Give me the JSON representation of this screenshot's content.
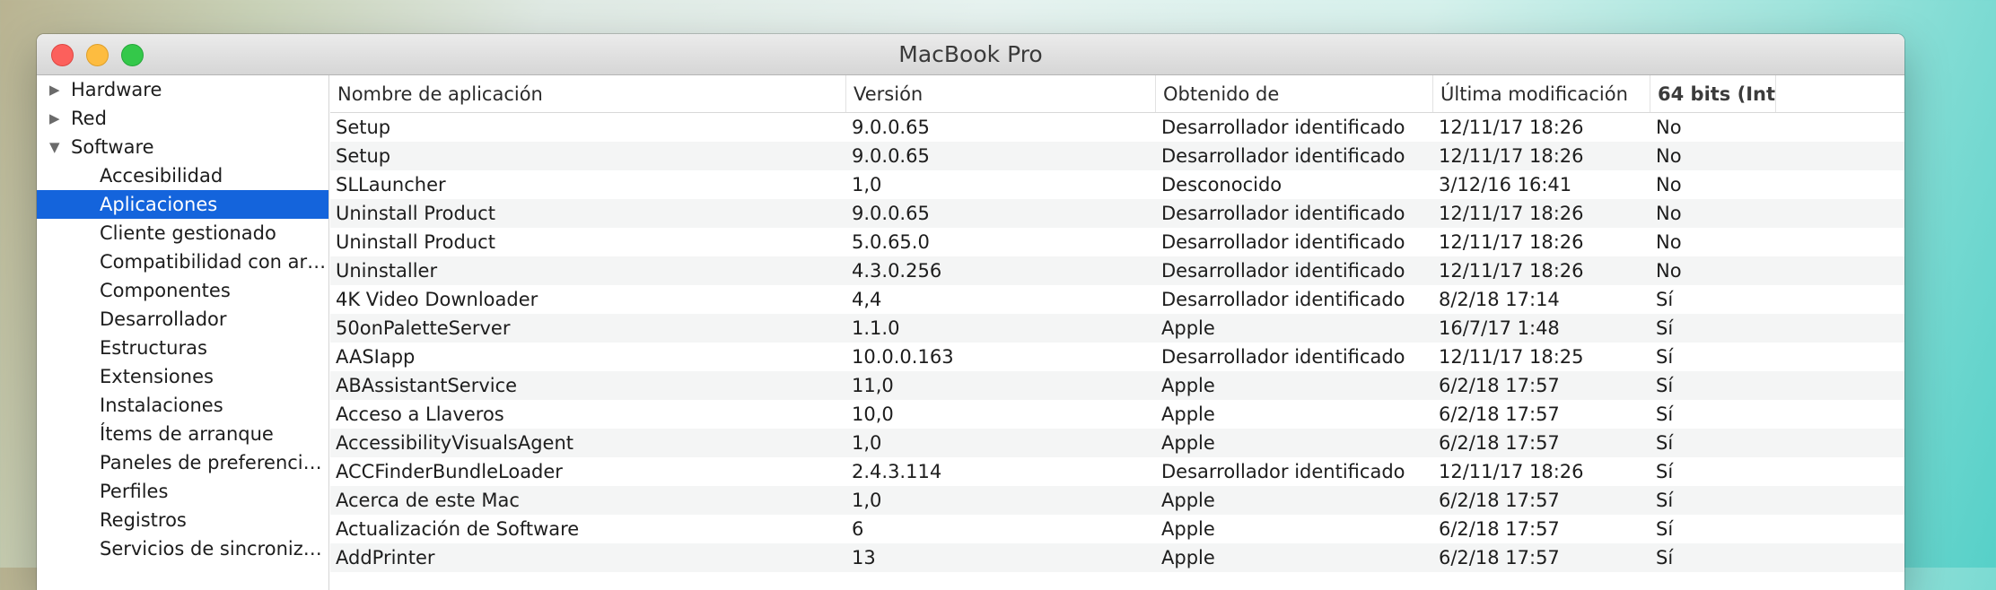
{
  "window": {
    "title": "MacBook Pro"
  },
  "sidebar": {
    "items": [
      {
        "label": "Hardware",
        "level": 0,
        "expanded": false,
        "selected": false
      },
      {
        "label": "Red",
        "level": 0,
        "expanded": false,
        "selected": false
      },
      {
        "label": "Software",
        "level": 0,
        "expanded": true,
        "selected": false
      },
      {
        "label": "Accesibilidad",
        "level": 1,
        "selected": false
      },
      {
        "label": "Aplicaciones",
        "level": 1,
        "selected": true
      },
      {
        "label": "Cliente gestionado",
        "level": 1,
        "selected": false
      },
      {
        "label": "Compatibilidad con ar…",
        "level": 1,
        "selected": false
      },
      {
        "label": "Componentes",
        "level": 1,
        "selected": false
      },
      {
        "label": "Desarrollador",
        "level": 1,
        "selected": false
      },
      {
        "label": "Estructuras",
        "level": 1,
        "selected": false
      },
      {
        "label": "Extensiones",
        "level": 1,
        "selected": false
      },
      {
        "label": "Instalaciones",
        "level": 1,
        "selected": false
      },
      {
        "label": "Ítems de arranque",
        "level": 1,
        "selected": false
      },
      {
        "label": "Paneles de preferenci…",
        "level": 1,
        "selected": false
      },
      {
        "label": "Perfiles",
        "level": 1,
        "selected": false
      },
      {
        "label": "Registros",
        "level": 1,
        "selected": false
      },
      {
        "label": "Servicios de sincroniz…",
        "level": 1,
        "selected": false
      }
    ]
  },
  "table": {
    "columns": [
      {
        "label": "Nombre de aplicación",
        "sorted": false
      },
      {
        "label": "Versión",
        "sorted": false
      },
      {
        "label": "Obtenido de",
        "sorted": false
      },
      {
        "label": "Última modificación",
        "sorted": false
      },
      {
        "label": "64 bits (Int…",
        "sorted": true,
        "sort_icon": "chevron-up-icon"
      }
    ],
    "rows": [
      [
        "Setup",
        "9.0.0.65",
        "Desarrollador identificado",
        "12/11/17 18:26",
        "No"
      ],
      [
        "Setup",
        "9.0.0.65",
        "Desarrollador identificado",
        "12/11/17 18:26",
        "No"
      ],
      [
        "SLLauncher",
        "1,0",
        "Desconocido",
        "3/12/16 16:41",
        "No"
      ],
      [
        "Uninstall Product",
        "9.0.0.65",
        "Desarrollador identificado",
        "12/11/17 18:26",
        "No"
      ],
      [
        "Uninstall Product",
        "5.0.65.0",
        "Desarrollador identificado",
        "12/11/17 18:26",
        "No"
      ],
      [
        "Uninstaller",
        "4.3.0.256",
        "Desarrollador identificado",
        "12/11/17 18:26",
        "No"
      ],
      [
        "4K Video Downloader",
        "4,4",
        "Desarrollador identificado",
        "8/2/18 17:14",
        "Sí"
      ],
      [
        "50onPaletteServer",
        "1.1.0",
        "Apple",
        "16/7/17 1:48",
        "Sí"
      ],
      [
        "AASIapp",
        "10.0.0.163",
        "Desarrollador identificado",
        "12/11/17 18:25",
        "Sí"
      ],
      [
        "ABAssistantService",
        "11,0",
        "Apple",
        "6/2/18 17:57",
        "Sí"
      ],
      [
        "Acceso a Llaveros",
        "10,0",
        "Apple",
        "6/2/18 17:57",
        "Sí"
      ],
      [
        "AccessibilityVisualsAgent",
        "1,0",
        "Apple",
        "6/2/18 17:57",
        "Sí"
      ],
      [
        "ACCFinderBundleLoader",
        "2.4.3.114",
        "Desarrollador identificado",
        "12/11/17 18:26",
        "Sí"
      ],
      [
        "Acerca de este Mac",
        "1,0",
        "Apple",
        "6/2/18 17:57",
        "Sí"
      ],
      [
        "Actualización de Software",
        "6",
        "Apple",
        "6/2/18 17:57",
        "Sí"
      ],
      [
        "AddPrinter",
        "13",
        "Apple",
        "6/2/18 17:57",
        "Sí"
      ]
    ]
  },
  "colors": {
    "selection": "#1464dc",
    "traffic_close": "#fc605c",
    "traffic_minimize": "#fdbc40",
    "traffic_zoom": "#34c84a",
    "row_alternate": "#f4f5f5"
  }
}
